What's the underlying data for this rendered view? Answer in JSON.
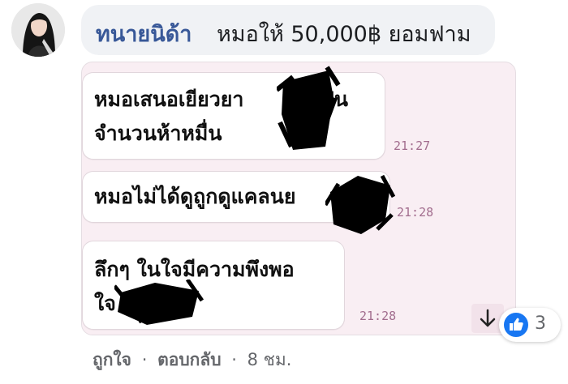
{
  "comment": {
    "author": "ทนายนิด้า",
    "text": "หมอให้ 50,000฿ ยอมฟาม"
  },
  "screenshot": {
    "messages": [
      {
        "lines": "หมอเสนอเยียวยา          เป็น\nจำนวนห้าหมื่น",
        "time": "21:27"
      },
      {
        "lines": "หมอไม่ได้ดูถูกดูแคลนย",
        "time": "21:28"
      },
      {
        "lines": "ลึกๆ ในใจมีความพึงพอ\nใจ",
        "time": "21:28"
      }
    ],
    "scroll_icon": "arrow-down-icon"
  },
  "reaction": {
    "icon": "thumbs-up-icon",
    "count": "3",
    "color": "#1877f2"
  },
  "actions": {
    "like": "ถูกใจ",
    "reply": "ตอบกลับ",
    "time": "8 ชม.",
    "separator": "·"
  }
}
